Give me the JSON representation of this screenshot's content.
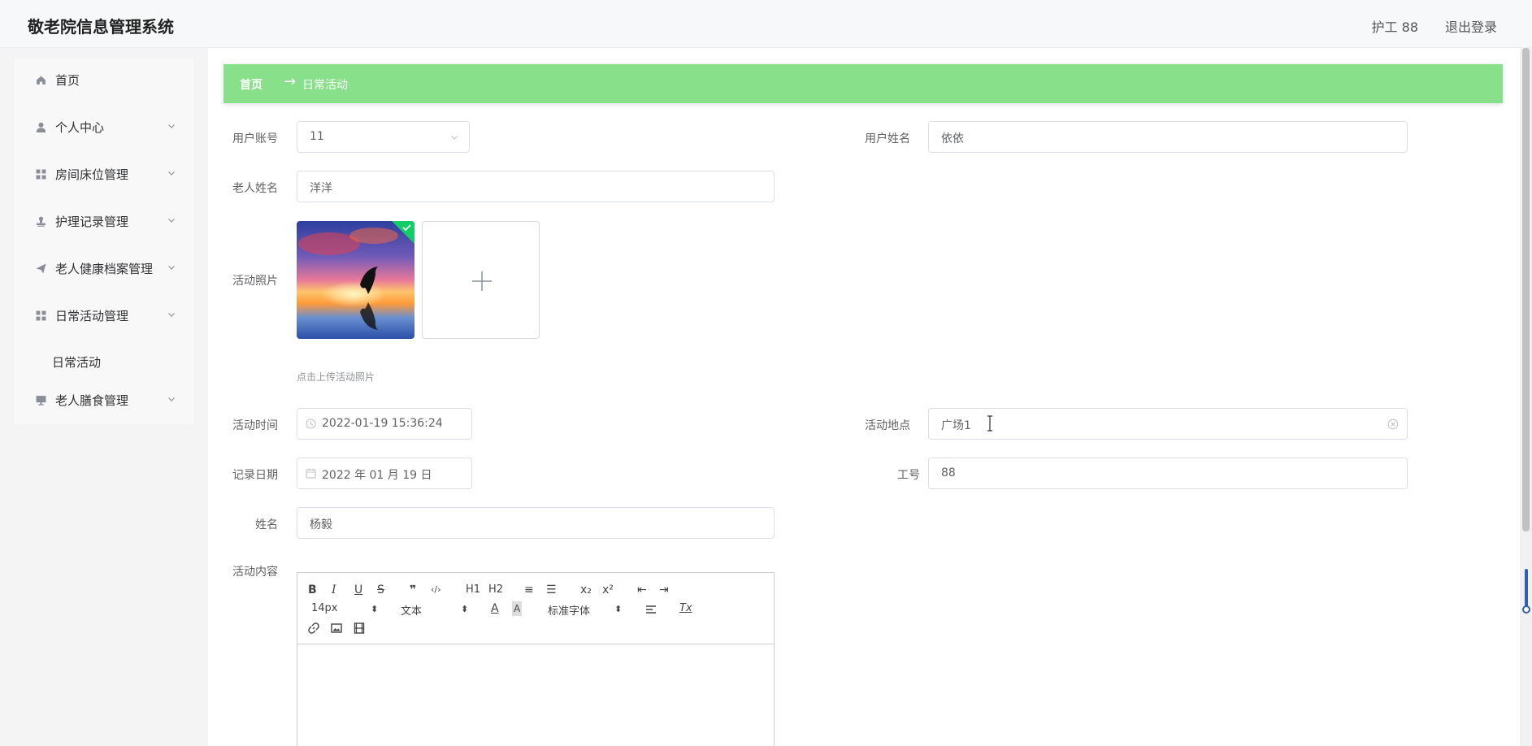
{
  "header": {
    "title": "敬老院信息管理系统",
    "user": "护工 88",
    "logout": "退出登录"
  },
  "sidebar": {
    "items": [
      {
        "label": "首页",
        "icon": "home-icon"
      },
      {
        "label": "个人中心",
        "icon": "person-icon"
      },
      {
        "label": "房间床位管理",
        "icon": "grid-icon"
      },
      {
        "label": "护理记录管理",
        "icon": "stamp-icon"
      },
      {
        "label": "老人健康档案管理",
        "icon": "send-icon"
      },
      {
        "label": "日常活动管理",
        "icon": "grid-icon"
      },
      {
        "label": "老人膳食管理",
        "icon": "monitor-icon"
      }
    ],
    "sub_item": "日常活动"
  },
  "breadcrumb": {
    "home": "首页",
    "separator": "→",
    "current": "日常活动"
  },
  "form": {
    "account": {
      "label": "用户账号",
      "value": "11"
    },
    "username": {
      "label": "用户姓名",
      "value": "依依"
    },
    "elder_name": {
      "label": "老人姓名",
      "value": "洋洋"
    },
    "photo": {
      "label": "活动照片",
      "hint": "点击上传活动照片"
    },
    "activity_time": {
      "label": "活动时间",
      "value": "2022-01-19 15:36:24"
    },
    "location": {
      "label": "活动地点",
      "value": "广场1"
    },
    "record_date": {
      "label": "记录日期",
      "value": "2022 年 01 月 19 日"
    },
    "job_no": {
      "label": "工号",
      "value": "88"
    },
    "name": {
      "label": "姓名",
      "value": "杨毅"
    },
    "content": {
      "label": "活动内容"
    }
  },
  "editor": {
    "buttons_row1": [
      "B",
      "I",
      "U",
      "S",
      "❞",
      "‹/›",
      "H1",
      "H2",
      "≡",
      "☰",
      "x₂",
      "x²",
      "⇤",
      "⇥"
    ],
    "size_select": "14px",
    "format_select": "文本",
    "font_select": "标准字体",
    "color_a": "A",
    "clear_format": "Tx"
  },
  "colors": {
    "breadcrumb_bg": "#89e08a",
    "success": "#13ce66"
  }
}
